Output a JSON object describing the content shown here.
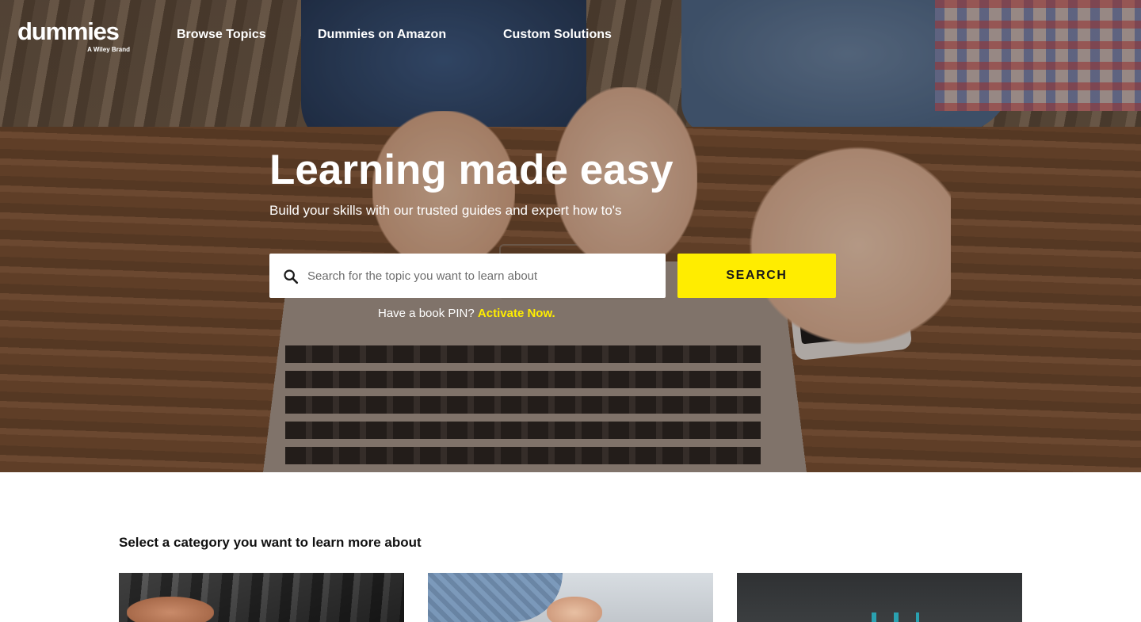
{
  "brand": {
    "name": "dummies",
    "tagline": "A Wiley Brand"
  },
  "nav": {
    "items": [
      {
        "label": "Browse Topics"
      },
      {
        "label": "Dummies on Amazon"
      },
      {
        "label": "Custom Solutions"
      }
    ]
  },
  "hero": {
    "title": "Learning made easy",
    "subtitle": "Build your skills with our trusted guides and expert how to's",
    "search": {
      "placeholder": "Search for the topic you want to learn about",
      "value": "",
      "button_label": "SEARCH"
    },
    "pin_prompt": "Have a book PIN?",
    "pin_link": "Activate Now."
  },
  "categories": {
    "heading": "Select a category you want to learn more about"
  },
  "colors": {
    "accent": "#ffed00",
    "text_dark": "#111111",
    "white": "#ffffff"
  },
  "icons": {
    "search": "search-icon"
  }
}
